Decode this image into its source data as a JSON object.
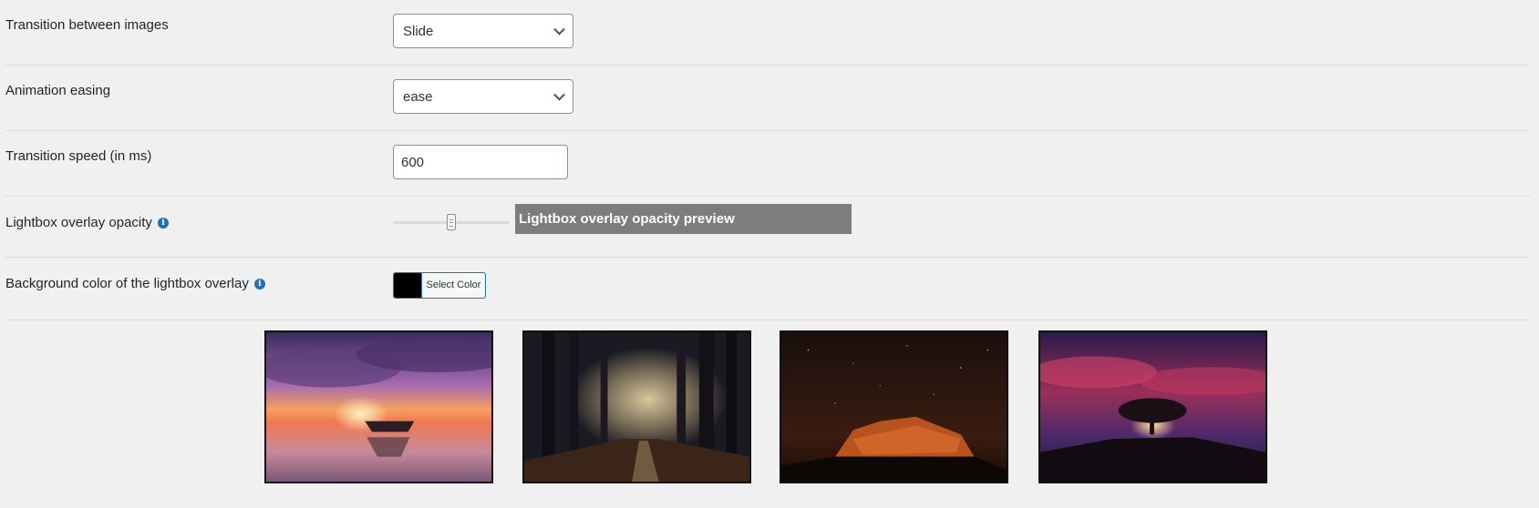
{
  "settings": {
    "transition": {
      "label": "Transition between images",
      "value": "Slide"
    },
    "easing": {
      "label": "Animation easing",
      "value": "ease"
    },
    "speed": {
      "label": "Transition speed (in ms)",
      "value": "600"
    },
    "opacity": {
      "label": "Lightbox overlay opacity",
      "preview_text": "Lightbox overlay opacity preview",
      "slider_level": 0.5
    },
    "bg_color": {
      "label": "Background color of the lightbox overlay",
      "button_label": "Select Color",
      "color": "#000000"
    }
  },
  "gallery": {
    "images": [
      {
        "subject": "sunset-lake-boat"
      },
      {
        "subject": "foggy-forest-path"
      },
      {
        "subject": "starry-night-rock"
      },
      {
        "subject": "lone-tree-red-sky"
      }
    ]
  },
  "colors": {
    "accent": "#2271b1",
    "preview_bg": "#7d7d7d",
    "page_bg": "#f0f0f1"
  }
}
